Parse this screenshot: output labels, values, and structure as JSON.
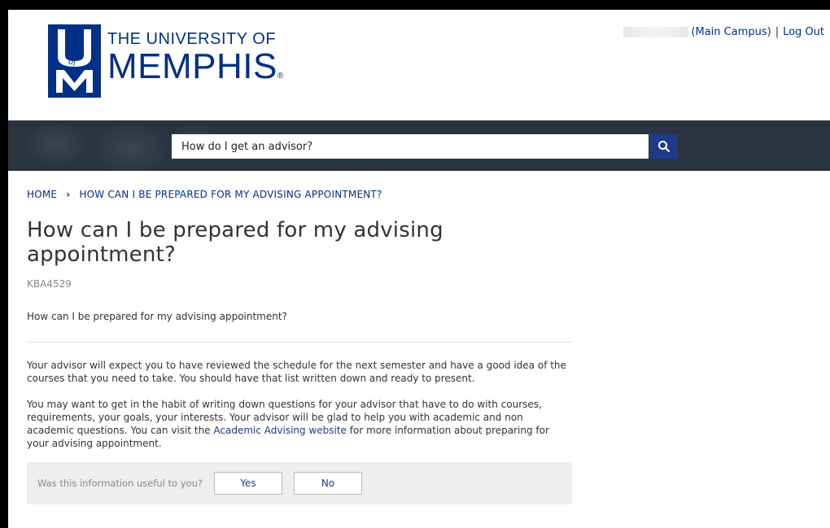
{
  "brand": {
    "line1": "THE UNIVERSITY OF",
    "line2": "MEMPHIS",
    "reg_mark": "®",
    "mark_letters": "U of M",
    "color": "#003087"
  },
  "user_bar": {
    "campus": "(Main Campus)",
    "separator": "|",
    "logout": "Log Out"
  },
  "search": {
    "value": "How do I get an advisor?",
    "button_icon": "search-icon",
    "button_color": "#1f3a8a"
  },
  "breadcrumb": {
    "home": "HOME",
    "separator_icon": "chevron-right-icon",
    "current": "HOW CAN I BE PREPARED FOR MY ADVISING APPOINTMENT?"
  },
  "article": {
    "title": "How can I be prepared for my advising appointment?",
    "id": "KBA4529",
    "question": "How can I be prepared for my advising appointment?",
    "paragraph1": "Your advisor will expect you to have reviewed the schedule for the next semester and have a good idea of the courses that you need to take. You should have that list written down and ready to present.",
    "paragraph2_before_link": "You may want to get in the habit of writing down questions for your advisor that have to do with courses, requirements, your goals, your interests. Your advisor will be glad to help you with academic and non academic questions. You can visit the ",
    "paragraph2_link": "Academic Advising website",
    "paragraph2_after_link": " for more information about preparing for your advising appointment."
  },
  "feedback": {
    "question": "Was this information useful to you?",
    "yes": "Yes",
    "no": "No"
  }
}
